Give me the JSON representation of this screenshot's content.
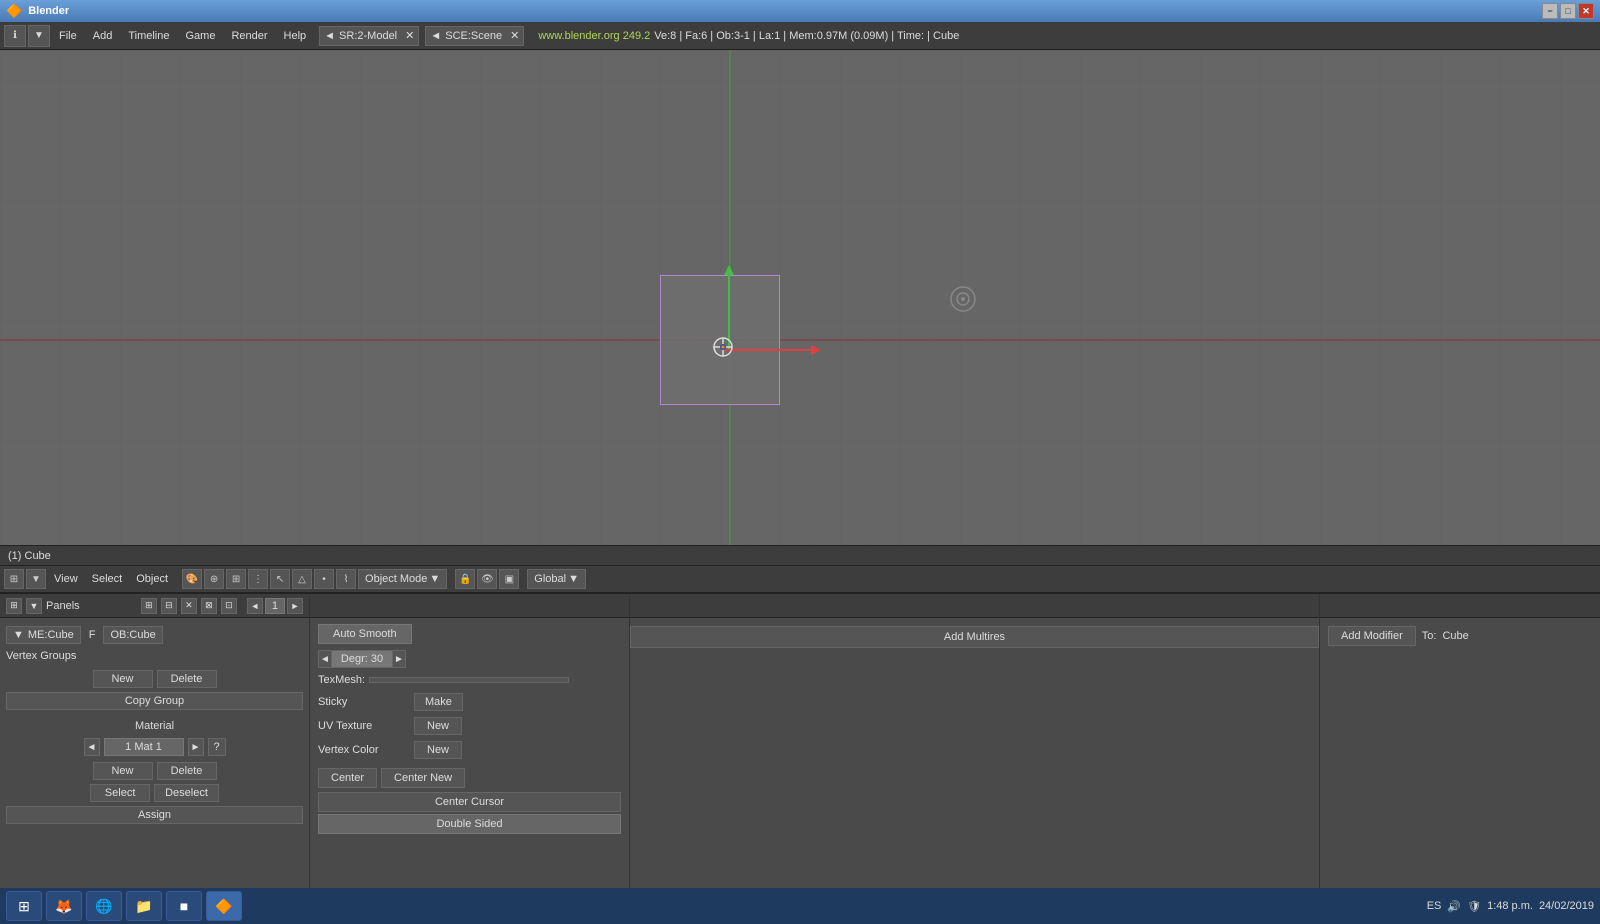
{
  "titlebar": {
    "icon": "B",
    "title": "Blender",
    "minimize_label": "−",
    "maximize_label": "□",
    "close_label": "✕"
  },
  "menubar": {
    "items": [
      "File",
      "Add",
      "Timeline",
      "Game",
      "Render",
      "Help"
    ],
    "scene_dropdown": "SR:2-Model",
    "sce_dropdown": "SCE:Scene",
    "website": "www.blender.org 249.2",
    "status": "Ve:8 | Fa:6 | Ob:3-1 | La:1 | Mem:0.97M (0.09M) | Time: | Cube"
  },
  "viewport_status": {
    "text": "(1) Cube"
  },
  "view_toolbar": {
    "menus": [
      "View",
      "Select",
      "Object"
    ],
    "mode_dropdown": "Object Mode",
    "pivot_dropdown": "Global",
    "page_num": "1"
  },
  "properties_header": {
    "me_label": "ME:Cube",
    "f_label": "F",
    "ob_label": "OB:Cube",
    "panels_label": "Panels"
  },
  "left_panel": {
    "vertex_groups": "Vertex Groups",
    "material": "Material",
    "mat_value": "1 Mat 1",
    "new_btn": "New",
    "delete_btn": "Delete",
    "copy_group_btn": "Copy Group",
    "select_btn": "Select",
    "deselect_btn": "Deselect",
    "assign_btn": "Assign",
    "mat_new_btn": "New",
    "mat_delete_btn": "Delete"
  },
  "mid_panel": {
    "auto_smooth_btn": "Auto Smooth",
    "degr_label": "Degr: 30",
    "texmesh_label": "TexMesh:",
    "sticky_label": "Sticky",
    "make_btn": "Make",
    "uv_texture_label": "UV Texture",
    "uv_new_btn": "New",
    "vertex_color_label": "Vertex Color",
    "vc_new_btn": "New",
    "center_btn": "Center",
    "center_new_btn": "Center New",
    "center_cursor_btn": "Center Cursor",
    "double_sided_btn": "Double Sided"
  },
  "right_panel1": {
    "add_multires_btn": "Add Multires"
  },
  "right_panel2": {
    "add_modifier_btn": "Add Modifier",
    "to_label": "To:",
    "to_value": "Cube"
  },
  "taskbar": {
    "start_icon": "⊞",
    "firefox_icon": "🦊",
    "network_icon": "🌐",
    "folder_icon": "📁",
    "taskbar_icon": "■",
    "blender_icon": "🔶",
    "locale": "ES",
    "time": "1:48 p.m.",
    "date": "24/02/2019"
  }
}
